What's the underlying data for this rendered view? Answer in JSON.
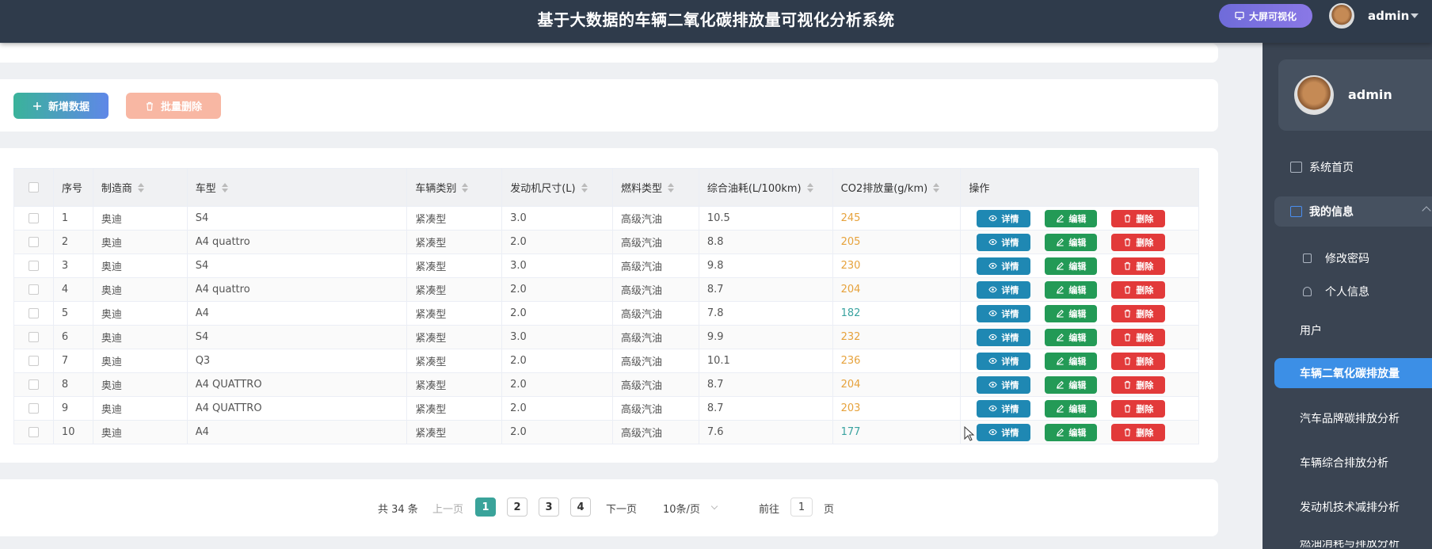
{
  "header": {
    "title": "基于大数据的车辆二氧化碳排放量可视化分析系统",
    "bigscreen_label": "大屏可视化",
    "username": "admin"
  },
  "actions": {
    "add_label": "新增数据",
    "batch_delete_label": "批量删除"
  },
  "table": {
    "columns": [
      "序号",
      "制造商",
      "车型",
      "车辆类别",
      "发动机尺寸(L)",
      "燃料类型",
      "综合油耗(L/100km)",
      "CO2排放量(g/km)",
      "操作"
    ],
    "rows": [
      {
        "idx": "1",
        "maker": "奥迪",
        "model": "S4",
        "type": "紧凑型",
        "engine": "3.0",
        "fuel": "高级汽油",
        "cons": "10.5",
        "co2": "245",
        "co2_color": "orange"
      },
      {
        "idx": "2",
        "maker": "奥迪",
        "model": "A4 quattro",
        "type": "紧凑型",
        "engine": "2.0",
        "fuel": "高级汽油",
        "cons": "8.8",
        "co2": "205",
        "co2_color": "orange"
      },
      {
        "idx": "3",
        "maker": "奥迪",
        "model": "S4",
        "type": "紧凑型",
        "engine": "3.0",
        "fuel": "高级汽油",
        "cons": "9.8",
        "co2": "230",
        "co2_color": "orange"
      },
      {
        "idx": "4",
        "maker": "奥迪",
        "model": "A4 quattro",
        "type": "紧凑型",
        "engine": "2.0",
        "fuel": "高级汽油",
        "cons": "8.7",
        "co2": "204",
        "co2_color": "orange"
      },
      {
        "idx": "5",
        "maker": "奥迪",
        "model": "A4",
        "type": "紧凑型",
        "engine": "2.0",
        "fuel": "高级汽油",
        "cons": "7.8",
        "co2": "182",
        "co2_color": "teal"
      },
      {
        "idx": "6",
        "maker": "奥迪",
        "model": "S4",
        "type": "紧凑型",
        "engine": "3.0",
        "fuel": "高级汽油",
        "cons": "9.9",
        "co2": "232",
        "co2_color": "orange"
      },
      {
        "idx": "7",
        "maker": "奥迪",
        "model": "Q3",
        "type": "紧凑型",
        "engine": "2.0",
        "fuel": "高级汽油",
        "cons": "10.1",
        "co2": "236",
        "co2_color": "orange"
      },
      {
        "idx": "8",
        "maker": "奥迪",
        "model": "A4 QUATTRO",
        "type": "紧凑型",
        "engine": "2.0",
        "fuel": "高级汽油",
        "cons": "8.7",
        "co2": "204",
        "co2_color": "orange"
      },
      {
        "idx": "9",
        "maker": "奥迪",
        "model": "A4 QUATTRO",
        "type": "紧凑型",
        "engine": "2.0",
        "fuel": "高级汽油",
        "cons": "8.7",
        "co2": "203",
        "co2_color": "orange"
      },
      {
        "idx": "10",
        "maker": "奥迪",
        "model": "A4",
        "type": "紧凑型",
        "engine": "2.0",
        "fuel": "高级汽油",
        "cons": "7.6",
        "co2": "177",
        "co2_color": "teal"
      }
    ],
    "row_actions": {
      "detail": "详情",
      "edit": "编辑",
      "delete": "删除"
    }
  },
  "pagination": {
    "total": "共 34 条",
    "prev": "上一页",
    "pages": [
      "1",
      "2",
      "3",
      "4"
    ],
    "current_page": "1",
    "next": "下一页",
    "page_size": "10条/页",
    "goto_prefix": "前往",
    "goto_value": "1",
    "goto_suffix": "页"
  },
  "sidebar": {
    "username": "admin",
    "home": "系统首页",
    "mine": "我的信息",
    "sub_password": "修改密码",
    "sub_profile": "个人信息",
    "users": "用户",
    "co2": "车辆二氧化碳排放量",
    "brand_analysis": "汽车品牌碳排放分析",
    "vehicle_analysis": "车辆综合排放分析",
    "engine_analysis": "发动机技术减排分析",
    "cut_off": "燃油消耗与排放分析"
  },
  "colors": {
    "header_bg": "#2f3b4b",
    "sidebar_bg": "#3a4452",
    "active_menu": "#3c8fe6",
    "co2_orange": "#e6a23c",
    "co2_teal": "#3aa3a0"
  }
}
